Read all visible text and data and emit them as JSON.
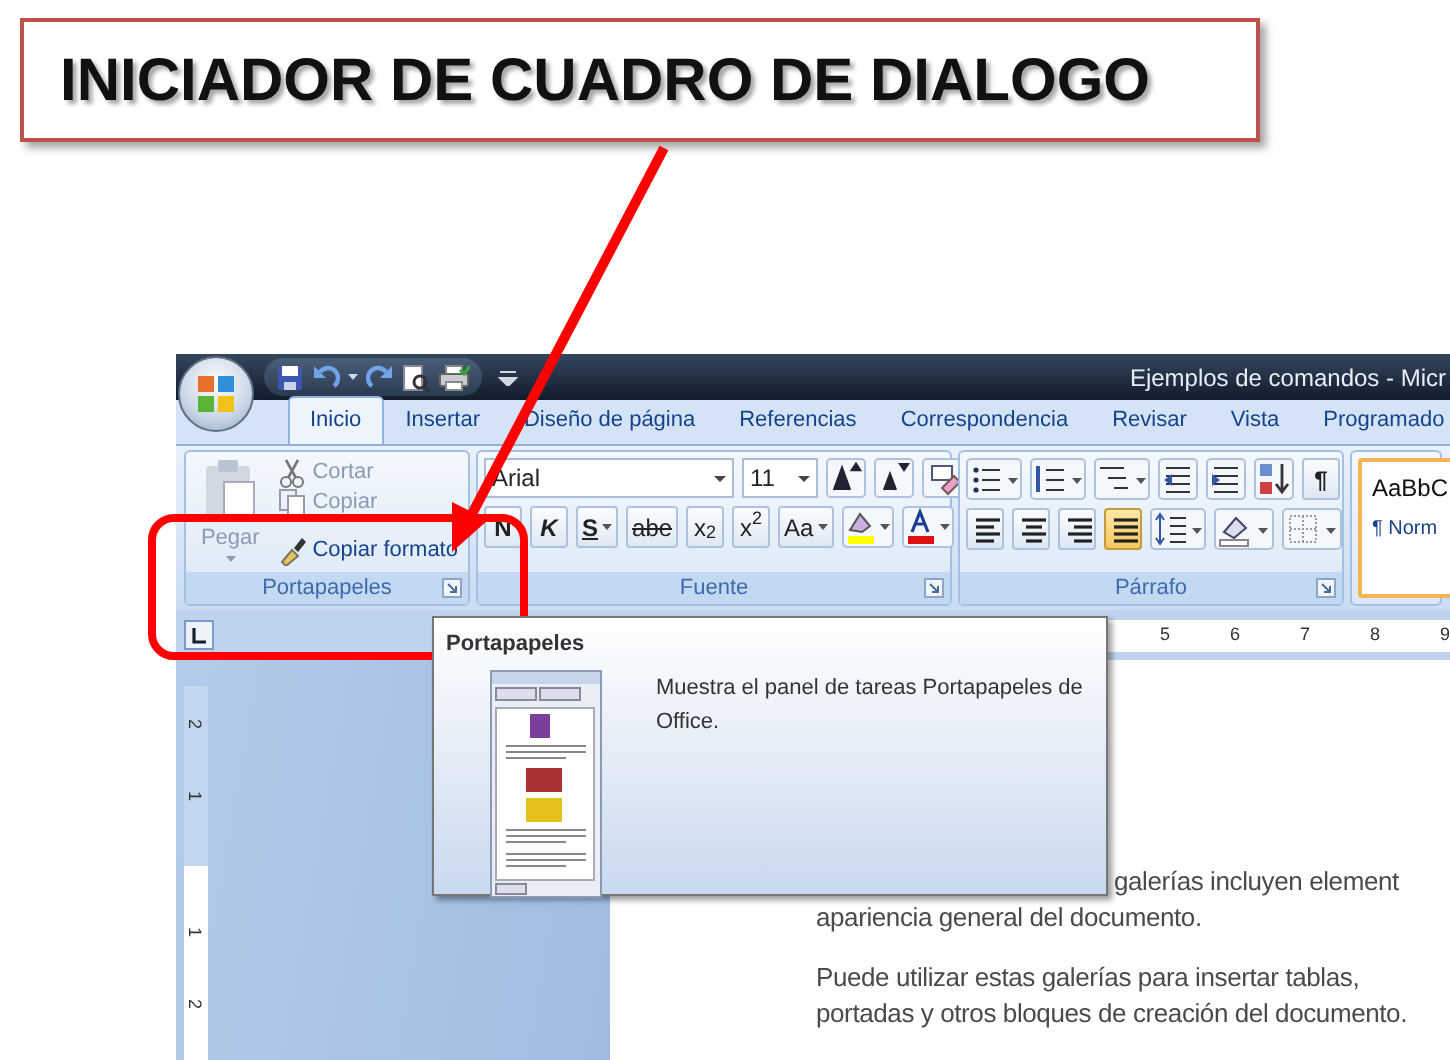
{
  "callout": {
    "text": "INICIADOR DE CUADRO DE DIALOGO"
  },
  "window": {
    "title": "Ejemplos de comandos - Micr"
  },
  "tabs": [
    {
      "label": "Inicio",
      "selected": true
    },
    {
      "label": "Insertar",
      "selected": false
    },
    {
      "label": "Diseño de página",
      "selected": false
    },
    {
      "label": "Referencias",
      "selected": false
    },
    {
      "label": "Correspondencia",
      "selected": false
    },
    {
      "label": "Revisar",
      "selected": false
    },
    {
      "label": "Vista",
      "selected": false
    },
    {
      "label": "Programado",
      "selected": false
    }
  ],
  "ribbon": {
    "groups": [
      {
        "kind": "clipboard",
        "label": "Portapapeles",
        "launcher": true,
        "paste": {
          "label": "Pegar",
          "disabled": true
        },
        "buttons": [
          {
            "kind": "cut",
            "label": "Cortar",
            "disabled": true
          },
          {
            "kind": "copy",
            "label": "Copiar",
            "disabled": true
          },
          {
            "kind": "brush",
            "label": "Copiar formato",
            "disabled": false
          }
        ]
      },
      {
        "kind": "font",
        "label": "Fuente",
        "launcher": true,
        "font_name": "Arial",
        "font_size": "11",
        "format_buttons": [
          {
            "kind": "bold",
            "label": "N"
          },
          {
            "kind": "italic",
            "label": "K"
          },
          {
            "kind": "underline",
            "label": "S"
          },
          {
            "kind": "strike",
            "label": "abe"
          },
          {
            "kind": "plain",
            "label": "x$_{2}$"
          },
          {
            "kind": "plain",
            "label": "x$^{2}$"
          },
          {
            "kind": "case",
            "label": "Aa"
          }
        ]
      },
      {
        "kind": "paragraph",
        "label": "Párrafo",
        "launcher": true,
        "pilcrow": "¶",
        "alignments": [
          {
            "kind": "left",
            "selected": false
          },
          {
            "kind": "center",
            "selected": false
          },
          {
            "kind": "right",
            "selected": false
          },
          {
            "kind": "justify",
            "selected": true
          }
        ]
      },
      {
        "kind": "styles",
        "styles": [
          {
            "sample": "AaBbC",
            "name": "¶ Norm",
            "selected": true
          }
        ]
      }
    ]
  },
  "rulers": {
    "horizontal": [
      "5",
      "6",
      "7",
      "8",
      "9"
    ],
    "vertical": [
      "2",
      "1",
      "1",
      "2"
    ]
  },
  "tooltip": {
    "title": "Portapapeles",
    "description": "Muestra el panel de tareas Portapapeles de Office."
  },
  "document": {
    "paragraphs": [
      {
        "lines": [
          "galerías incluyen element",
          "apariencia general del documento."
        ]
      },
      {
        "lines": [
          "Puede utilizar estas galerías para insertar tablas,",
          "portadas y otros bloques de creación del documento."
        ]
      }
    ]
  }
}
